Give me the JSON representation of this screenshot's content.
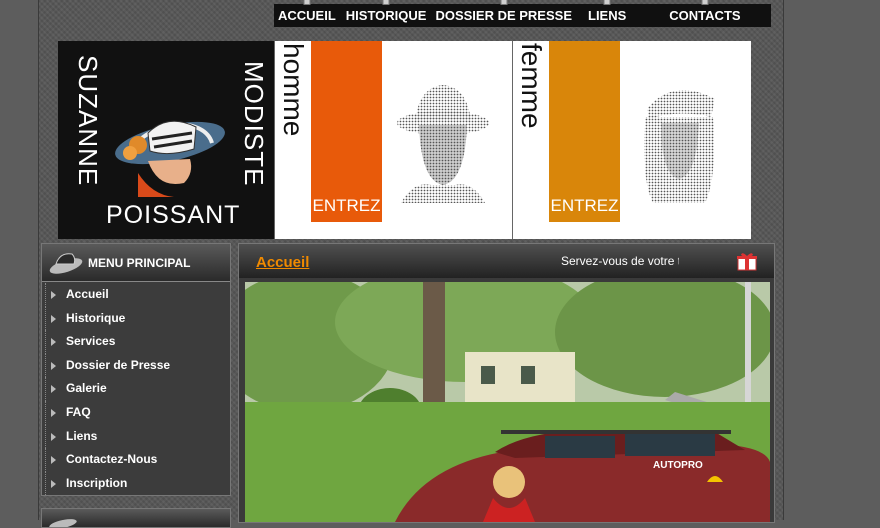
{
  "nav": {
    "items": [
      "ACCUEIL",
      "HISTORIQUE",
      "DOSSIER DE PRESSE",
      "LIENS",
      "CONTACTS"
    ]
  },
  "banner": {
    "name_first": "SUZANNE",
    "name_last": "POISSANT",
    "profession": "MODISTE",
    "sections": [
      {
        "word": "homme",
        "enter": "ENTREZ",
        "color": "#e85a0a"
      },
      {
        "word": "femme",
        "enter": "ENTREZ",
        "color": "#d9860a"
      }
    ]
  },
  "menu": {
    "title": "MENU PRINCIPAL",
    "items": [
      "Accueil",
      "Historique",
      "Services",
      "Dossier de Presse",
      "Galerie",
      "FAQ",
      "Liens",
      "Contactez-Nous",
      "Inscription"
    ]
  },
  "content": {
    "title": "Accueil",
    "marquee": "Servez-vous de votre t",
    "photo_badges": [
      "AUTOPRO"
    ]
  },
  "icons": {
    "menu_header": "hat-icon",
    "content_header": "gift-icon",
    "menu_bullet": "arrow-bullet-icon"
  },
  "colors": {
    "accent_orange": "#f08a00",
    "enter_orange": "#e85a0a",
    "enter_amber": "#d9860a"
  }
}
